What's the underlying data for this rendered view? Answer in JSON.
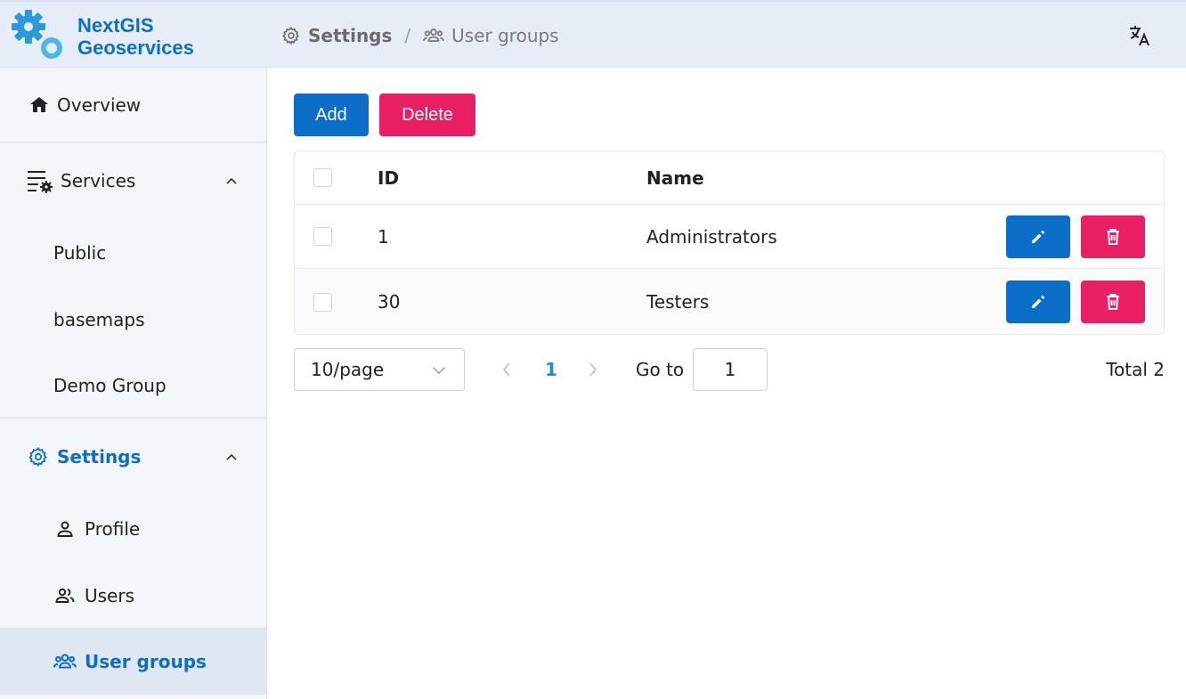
{
  "app": {
    "title_line1": "NextGIS",
    "title_line2": "Geoservices",
    "brand_color": "#0b6ec9",
    "accent_color": "#e91e63",
    "logo_icon": "gears-logo-icon"
  },
  "breadcrumb": {
    "items": [
      {
        "label": "Settings",
        "icon": "gear-icon"
      },
      {
        "label": "User groups",
        "icon": "user-group-icon"
      }
    ],
    "separator": "/"
  },
  "header": {
    "language_icon": "translate-icon"
  },
  "sidebar": {
    "items": [
      {
        "label": "Overview",
        "icon": "home-icon"
      },
      {
        "label": "Services",
        "icon": "services-settings-icon",
        "expanded": true
      },
      {
        "label": "Public"
      },
      {
        "label": "basemaps"
      },
      {
        "label": "Demo Group"
      },
      {
        "label": "Settings",
        "icon": "gear-icon",
        "expanded": true,
        "active": true
      },
      {
        "label": "Profile",
        "icon": "person-icon"
      },
      {
        "label": "Users",
        "icon": "users-icon"
      },
      {
        "label": "User groups",
        "icon": "user-group-icon",
        "selected": true
      }
    ]
  },
  "toolbar": {
    "add_label": "Add",
    "delete_label": "Delete"
  },
  "table": {
    "columns": [
      "ID",
      "Name"
    ],
    "rows": [
      {
        "id": "1",
        "name": "Administrators"
      },
      {
        "id": "30",
        "name": "Testers"
      }
    ]
  },
  "pagination": {
    "page_size": "10/page",
    "current_page": "1",
    "goto_label": "Go to",
    "goto_value": "1",
    "total": "Total 2"
  }
}
